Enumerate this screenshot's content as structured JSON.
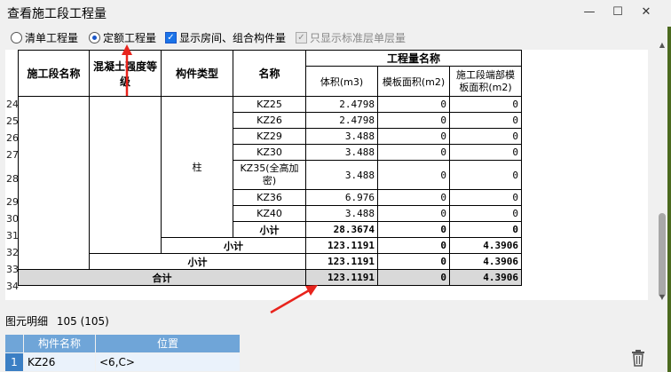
{
  "window": {
    "title": "查看施工段工程量",
    "minimize": "—",
    "maximize": "☐",
    "close": "✕"
  },
  "toolbar": {
    "opt_bill": "清单工程量",
    "opt_quota": "定额工程量",
    "chk_show_room": "显示房间、组合构件量",
    "chk_std_floor": "只显示标准层单层量"
  },
  "grid": {
    "headers": {
      "section": "施工段名称",
      "concrete": "混凝土强度等级",
      "type": "构件类型",
      "name": "名称",
      "qty_group": "工程量名称",
      "volume": "体积(m3)",
      "formwork": "模板面积(m2)",
      "end_formwork": "施工段端部模板面积(m2)"
    },
    "type_value": "柱",
    "row_numbers": [
      "24",
      "25",
      "26",
      "27",
      "28",
      "29",
      "30",
      "31",
      "32",
      "33",
      "34"
    ],
    "rows": [
      {
        "name": "KZ25",
        "volume": "2.4798",
        "formwork": "0",
        "end": "0"
      },
      {
        "name": "KZ26",
        "volume": "2.4798",
        "formwork": "0",
        "end": "0"
      },
      {
        "name": "KZ29",
        "volume": "3.488",
        "formwork": "0",
        "end": "0"
      },
      {
        "name": "KZ30",
        "volume": "3.488",
        "formwork": "0",
        "end": "0"
      },
      {
        "name": "KZ35(全高加密)",
        "volume": "3.488",
        "formwork": "0",
        "end": "0"
      },
      {
        "name": "KZ36",
        "volume": "6.976",
        "formwork": "0",
        "end": "0"
      },
      {
        "name": "KZ40",
        "volume": "3.488",
        "formwork": "0",
        "end": "0"
      }
    ],
    "subtotal_type": {
      "label": "小计",
      "volume": "28.3674",
      "formwork": "0",
      "end": "0"
    },
    "subtotal_concrete": {
      "label": "小计",
      "volume": "123.1191",
      "formwork": "0",
      "end": "4.3906"
    },
    "subtotal_section": {
      "label": "小计",
      "volume": "123.1191",
      "formwork": "0",
      "end": "4.3906"
    },
    "total": {
      "label": "合计",
      "volume": "123.1191",
      "formwork": "0",
      "end": "4.3906"
    }
  },
  "detail": {
    "title": "图元明细",
    "count": "105 (105)",
    "col_name": "构件名称",
    "col_pos": "位置",
    "row_num": "1",
    "row_name": "KZ26",
    "row_pos": "<6,C>"
  },
  "colors": {
    "accent": "#1a73e8",
    "header_blue": "#6fa5d8",
    "annotation": "#e8231c"
  }
}
